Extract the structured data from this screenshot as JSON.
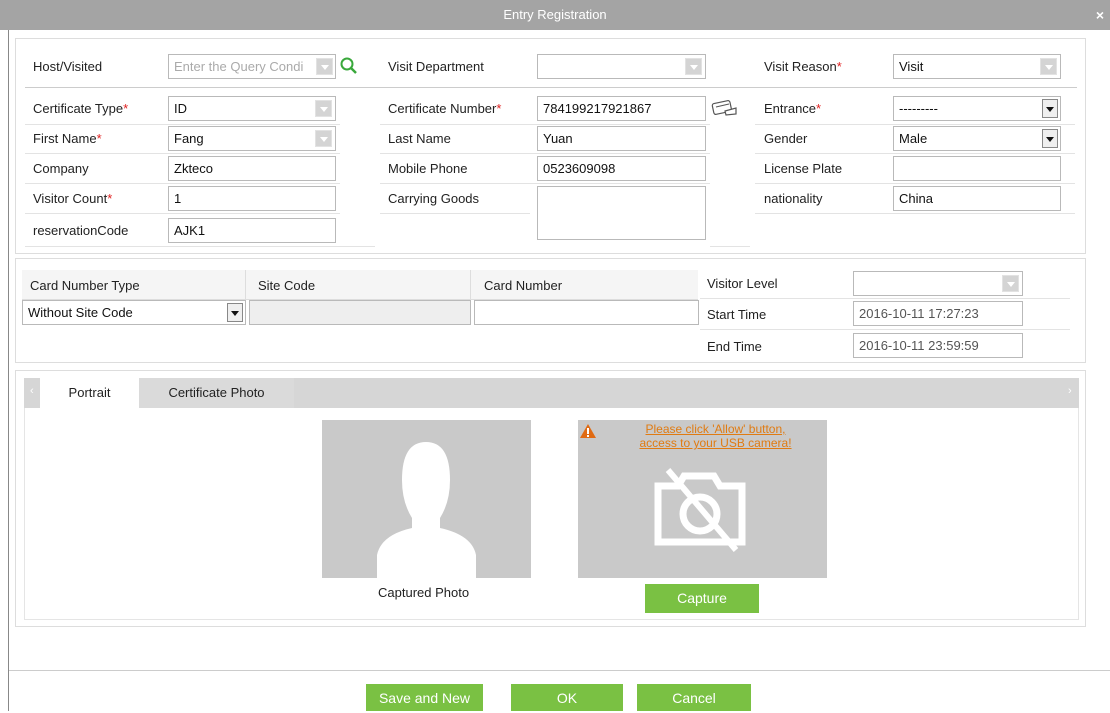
{
  "window": {
    "title": "Entry Registration",
    "close": "×"
  },
  "form": {
    "host_label": "Host/Visited",
    "host_placeholder": "Enter the Query Condi",
    "visit_dept_label": "Visit Department",
    "visit_dept_value": "",
    "visit_reason_label": "Visit Reason",
    "visit_reason_value": "Visit",
    "cert_type_label": "Certificate Type",
    "cert_type_value": "ID",
    "cert_number_label": "Certificate Number",
    "cert_number_value": "784199217921867",
    "entrance_label": "Entrance",
    "entrance_value": "---------",
    "first_name_label": "First Name",
    "first_name_value": "Fang",
    "last_name_label": "Last Name",
    "last_name_value": "Yuan",
    "gender_label": "Gender",
    "gender_value": "Male",
    "company_label": "Company",
    "company_value": "Zkteco",
    "mobile_label": "Mobile Phone",
    "mobile_value": "0523609098",
    "license_label": "License Plate",
    "license_value": "",
    "visitor_count_label": "Visitor Count",
    "visitor_count_value": "1",
    "carrying_label": "Carrying Goods",
    "carrying_value": "",
    "nationality_label": "nationality",
    "nationality_value": "China",
    "reservation_label": "reservationCode",
    "reservation_value": "AJK1",
    "required_mark": "*"
  },
  "card": {
    "type_header": "Card Number Type",
    "site_header": "Site Code",
    "number_header": "Card Number",
    "type_value": "Without Site Code",
    "site_value": "",
    "number_value": "",
    "level_label": "Visitor Level",
    "level_value": "",
    "start_label": "Start Time",
    "start_value": "2016-10-11 17:27:23",
    "end_label": "End Time",
    "end_value": "2016-10-11 23:59:59"
  },
  "photo": {
    "tabs": [
      "Portrait",
      "Certificate Photo"
    ],
    "captured_label": "Captured Photo",
    "camera_warning_line1": "Please click 'Allow' button,",
    "camera_warning_line2": "access to your USB camera!",
    "capture_button": "Capture"
  },
  "footer": {
    "save_new": "Save and New",
    "ok": "OK",
    "cancel": "Cancel"
  },
  "colors": {
    "accent": "#7ac143",
    "titlebar": "#a4a4a4",
    "required": "#e02020",
    "warning": "#e07b12"
  }
}
